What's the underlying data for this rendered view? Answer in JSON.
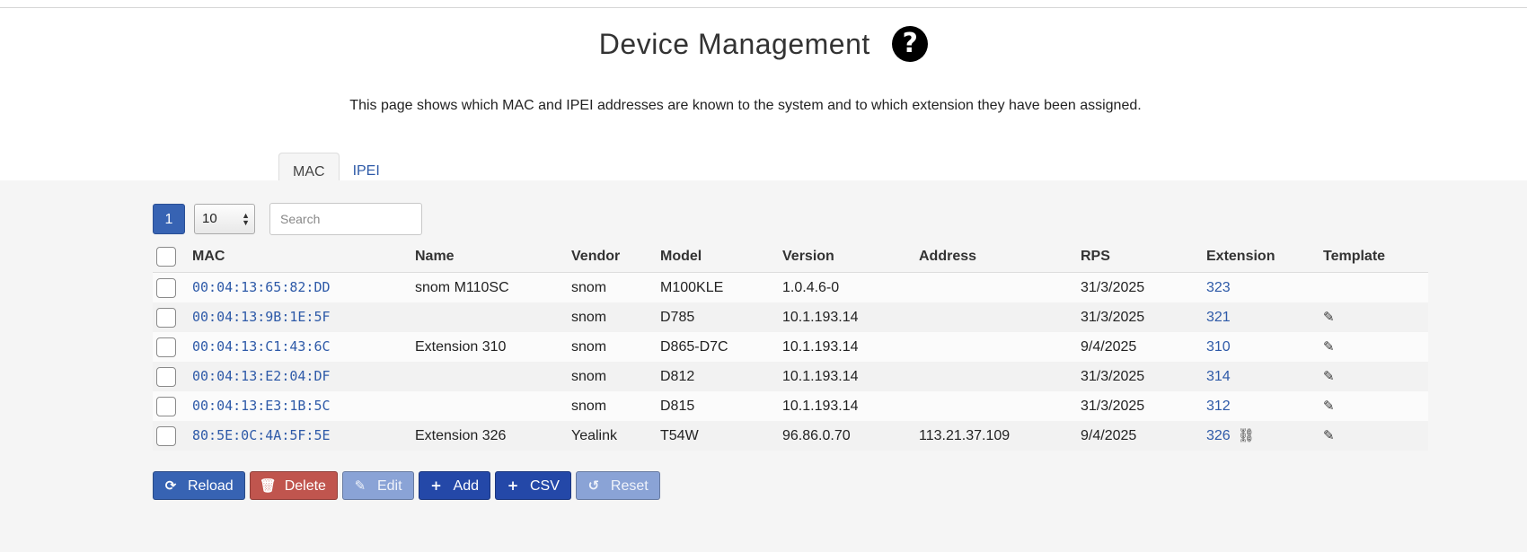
{
  "header": {
    "title": "Device Management",
    "help_icon": "?",
    "description": "This page shows which MAC and IPEI addresses are known to the system and to which extension they have been assigned."
  },
  "tabs": [
    {
      "label": "MAC",
      "active": true
    },
    {
      "label": "IPEI",
      "active": false
    }
  ],
  "controls": {
    "page": "1",
    "page_size": "10",
    "search_placeholder": "Search"
  },
  "table": {
    "columns": [
      "MAC",
      "Name",
      "Vendor",
      "Model",
      "Version",
      "Address",
      "RPS",
      "Extension",
      "Template"
    ],
    "rows": [
      {
        "mac": "00:04:13:65:82:DD",
        "name": "snom M110SC",
        "vendor": "snom",
        "model": "M100KLE",
        "version": "1.0.4.6-0",
        "address": "",
        "rps": "31/3/2025",
        "extension": "323",
        "template": false,
        "linked": false
      },
      {
        "mac": "00:04:13:9B:1E:5F",
        "name": "",
        "vendor": "snom",
        "model": "D785",
        "version": "10.1.193.14",
        "address": "",
        "rps": "31/3/2025",
        "extension": "321",
        "template": true,
        "linked": false
      },
      {
        "mac": "00:04:13:C1:43:6C",
        "name": "Extension 310",
        "vendor": "snom",
        "model": "D865-D7C",
        "version": "10.1.193.14",
        "address": "",
        "rps": "9/4/2025",
        "extension": "310",
        "template": true,
        "linked": false
      },
      {
        "mac": "00:04:13:E2:04:DF",
        "name": "",
        "vendor": "snom",
        "model": "D812",
        "version": "10.1.193.14",
        "address": "",
        "rps": "31/3/2025",
        "extension": "314",
        "template": true,
        "linked": false
      },
      {
        "mac": "00:04:13:E3:1B:5C",
        "name": "",
        "vendor": "snom",
        "model": "D815",
        "version": "10.1.193.14",
        "address": "",
        "rps": "31/3/2025",
        "extension": "312",
        "template": true,
        "linked": false
      },
      {
        "mac": "80:5E:0C:4A:5F:5E",
        "name": "Extension 326",
        "vendor": "Yealink",
        "model": "T54W",
        "version": "96.86.0.70",
        "address": "113.21.37.109",
        "rps": "9/4/2025",
        "extension": "326",
        "template": true,
        "linked": true
      }
    ]
  },
  "actions": [
    {
      "label": "Reload",
      "icon": "reload-icon",
      "style": "blue"
    },
    {
      "label": "Delete",
      "icon": "trash-icon",
      "style": "red"
    },
    {
      "label": "Edit",
      "icon": "pencil-icon",
      "style": "light"
    },
    {
      "label": "Add",
      "icon": "plus-icon",
      "style": "navy"
    },
    {
      "label": "CSV",
      "icon": "plus-icon",
      "style": "navy"
    },
    {
      "label": "Reset",
      "icon": "undo-icon",
      "style": "light"
    }
  ],
  "colors": {
    "accent": "#3763b3",
    "navy": "#2448a8",
    "danger": "#c0554e",
    "disabled": "#8aa3d6",
    "link": "#2e5aa8"
  }
}
